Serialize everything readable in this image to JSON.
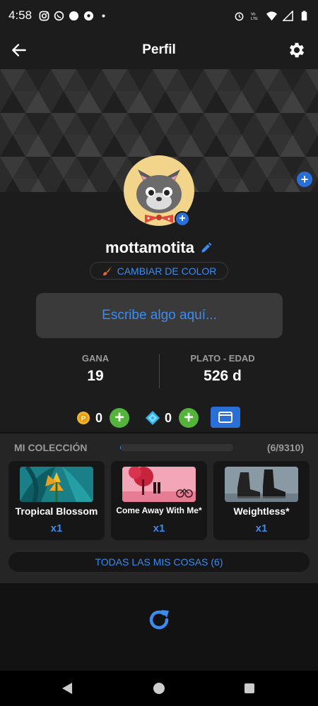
{
  "status_bar": {
    "time": "4:58",
    "left_icons": [
      "instagram-icon",
      "whatsapp-icon",
      "circle-icon",
      "soccer-icon",
      "dot-icon"
    ],
    "right_icons": [
      "alarm-icon",
      "volte-icon",
      "wifi-icon",
      "signal-icon",
      "battery-icon"
    ]
  },
  "header": {
    "title": "Perfil"
  },
  "profile": {
    "username": "mottamotita",
    "change_color_label": "CAMBIAR DE COLOR",
    "bio_placeholder": "Escribe algo aquí..."
  },
  "stats": {
    "wins_label": "GANA",
    "wins_value": "19",
    "age_label": "PLATO - EDAD",
    "age_value": "526 d"
  },
  "currency": {
    "coins": "0",
    "gems": "0"
  },
  "collection": {
    "title": "MI COLECCIÓN",
    "count": "(6/9310)",
    "progress_fraction": 0.00064,
    "items": [
      {
        "title": "Tropical Blossom",
        "qty": "x1"
      },
      {
        "title": "Come Away With Me*",
        "qty": "x1"
      },
      {
        "title": "Weightless*",
        "qty": "x1"
      }
    ],
    "all_items_label": "TODAS LAS MIS COSAS (6)"
  },
  "colors": {
    "accent_blue": "#3d8bf0",
    "button_blue": "#2a6fd6",
    "plus_green": "#53b33a",
    "background": "#121212",
    "card": "#161616"
  }
}
